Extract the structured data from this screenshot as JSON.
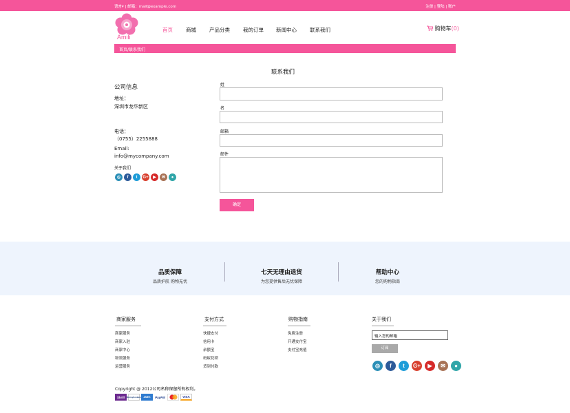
{
  "topbar": {
    "left_text": "语言▾ | 邮箱：mail@example.com",
    "right_text": "注册 | 登陆 | 账户"
  },
  "logo": {
    "text": "Amili"
  },
  "nav": {
    "items": [
      "首页",
      "商城",
      "产品分类",
      "我的订单",
      "新闻中心",
      "联系我们"
    ],
    "active_index": 0
  },
  "cart": {
    "label": "购物车",
    "count": "(0)"
  },
  "breadcrumb": "首页/联系我们",
  "page_title": "联系我们",
  "company": {
    "title": "公司信息",
    "address_label": "地址：",
    "address": "深圳市龙华新区",
    "phone_label": "电话：",
    "phone": "（0755）2255888",
    "email_label": "Email:",
    "email": "info@mycompany.com",
    "about_label": "关于我们"
  },
  "form": {
    "last_name_label": "姓",
    "first_name_label": "名",
    "email_label": "邮箱",
    "message_label": "邮件",
    "submit_label": "确定"
  },
  "features": [
    {
      "title": "品质保障",
      "desc": "品质护航 购物无忧"
    },
    {
      "title": "七天无理由退货",
      "desc": "为您提供售后无忧保障"
    },
    {
      "title": "帮助中心",
      "desc": "您的购物指南"
    }
  ],
  "footer": {
    "columns": [
      {
        "title": "商家服务",
        "items": [
          "商家服务",
          "商家入驻",
          "商家中心",
          "物流服务",
          "运营服务"
        ]
      },
      {
        "title": "支付方式",
        "items": [
          "快捷支付",
          "信用卡",
          "余额宝",
          "蚂蚁花呗",
          "货到付款"
        ]
      },
      {
        "title": "购物指南",
        "items": [
          "免费注册",
          "开通支付宝",
          "支付宝充值"
        ]
      }
    ],
    "about_title": "关于我们",
    "subscribe_value": "输入您的邮箱",
    "subscribe_button": "订阅",
    "copyright": "Copyright @ 2012公司名称保留所有权利。",
    "payments": [
      "Skrill",
      "Moneybookers",
      "AMEX",
      "PayPal",
      "MasterCard",
      "VISA"
    ]
  },
  "social_icons": [
    {
      "name": "instagram-icon",
      "glyph": "◎",
      "color": "#2b8fb7"
    },
    {
      "name": "facebook-icon",
      "glyph": "f",
      "color": "#2d5b9a"
    },
    {
      "name": "twitter-icon",
      "glyph": "t",
      "color": "#1d9cd8"
    },
    {
      "name": "google-plus-icon",
      "glyph": "G+",
      "color": "#d8402e"
    },
    {
      "name": "youtube-icon",
      "glyph": "▶",
      "color": "#d62a2a"
    },
    {
      "name": "mail-icon",
      "glyph": "✉",
      "color": "#a87255"
    },
    {
      "name": "location-icon",
      "glyph": "●",
      "color": "#2fa5a8"
    }
  ],
  "colors": {
    "brand_pink": "#f5559a",
    "feature_band": "#eef4fd"
  }
}
